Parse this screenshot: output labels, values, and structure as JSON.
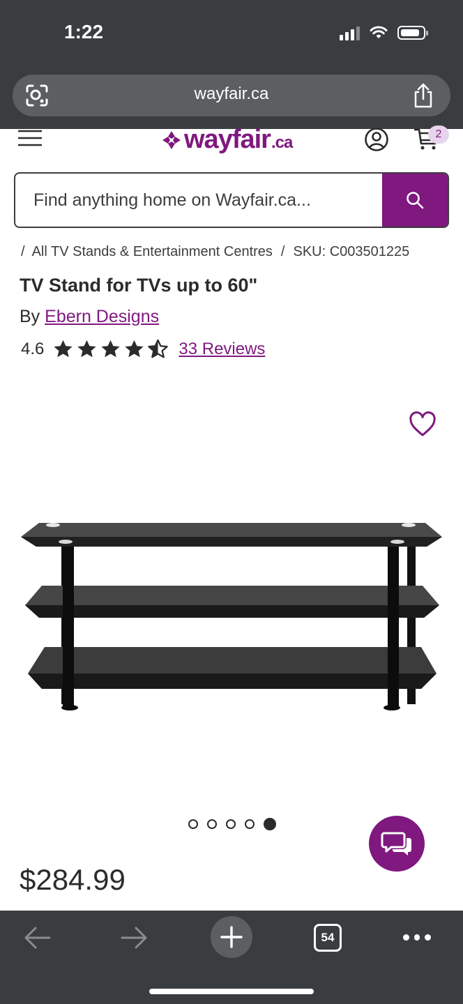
{
  "status_bar": {
    "time": "1:22"
  },
  "browser": {
    "url": "wayfair.ca",
    "tab_count": "54"
  },
  "header": {
    "logo_text": "wayfair",
    "logo_suffix": ".ca",
    "cart_count": "2",
    "brand_color": "#7f187f"
  },
  "search": {
    "placeholder": "Find anything home on Wayfair.ca..."
  },
  "breadcrumb": {
    "category": "All TV Stands & Entertainment Centres",
    "sku": "SKU: C003501225"
  },
  "product": {
    "title": "TV Stand for TVs up to 60\"",
    "by_prefix": "By",
    "brand": "Ebern Designs",
    "rating": "4.6",
    "rating_value": 4.6,
    "reviews": "33 Reviews",
    "price": "$284.99"
  },
  "gallery": {
    "image_count": 5,
    "active_index": 4
  },
  "icons": {
    "lens": "lens-icon",
    "share": "share-icon",
    "menu": "menu-icon",
    "account": "account-icon",
    "cart": "cart-icon",
    "search": "search-icon",
    "wishlist": "heart-icon",
    "chat": "chat-icon",
    "back": "back-arrow-icon",
    "forward": "forward-arrow-icon",
    "new_tab": "plus-icon",
    "more": "more-icon"
  }
}
